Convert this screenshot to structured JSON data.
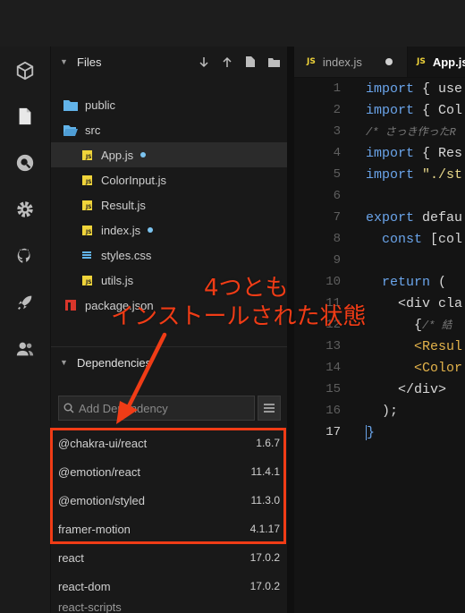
{
  "files_panel": {
    "title": "Files",
    "items": [
      {
        "name": "public",
        "type": "folder"
      },
      {
        "name": "src",
        "type": "folder-open"
      },
      {
        "name": "App.js",
        "type": "js",
        "modified": true,
        "selected": true
      },
      {
        "name": "ColorInput.js",
        "type": "js"
      },
      {
        "name": "Result.js",
        "type": "js"
      },
      {
        "name": "index.js",
        "type": "js",
        "modified": true
      },
      {
        "name": "styles.css",
        "type": "css"
      },
      {
        "name": "utils.js",
        "type": "js"
      },
      {
        "name": "package.json",
        "type": "package"
      }
    ]
  },
  "dependencies_panel": {
    "title": "Dependencies",
    "search_placeholder": "Add Dependency",
    "items": [
      {
        "name": "@chakra-ui/react",
        "version": "1.6.7"
      },
      {
        "name": "@emotion/react",
        "version": "11.4.1"
      },
      {
        "name": "@emotion/styled",
        "version": "11.3.0"
      },
      {
        "name": "framer-motion",
        "version": "4.1.17"
      },
      {
        "name": "react",
        "version": "17.0.2"
      },
      {
        "name": "react-dom",
        "version": "17.0.2"
      }
    ]
  },
  "editor": {
    "tabs": [
      {
        "label": "index.js",
        "modified": true
      },
      {
        "label": "App.js",
        "active": true
      }
    ],
    "line_numbers": [
      "1",
      "2",
      "3",
      "4",
      "5",
      "6",
      "7",
      "8",
      "9",
      "10",
      "11",
      "12",
      "13",
      "14",
      "15",
      "16",
      "17"
    ],
    "current_line": "17",
    "lines": [
      {
        "kw": "import",
        "rest": " { use"
      },
      {
        "kw": "import",
        "rest": " { Col"
      },
      {
        "comment": "/* さっき作ったR"
      },
      {
        "kw": "import",
        "rest": " { Res"
      },
      {
        "kw": "import",
        "str": " \"./st"
      },
      {
        "rest": ""
      },
      {
        "kw": "export",
        "rest": " defau"
      },
      {
        "kw": "  const",
        "rest": " [col"
      },
      {
        "rest": ""
      },
      {
        "kw": "  return",
        "rest": " ("
      },
      {
        "rest": "    <div cla"
      },
      {
        "rest": "      {",
        "comment": "/* 結"
      },
      {
        "tag": "      <Resul"
      },
      {
        "tag": "      <Color"
      },
      {
        "rest": "    </div>"
      },
      {
        "rest": "  );"
      },
      {
        "rest": "}"
      }
    ]
  },
  "annotation": {
    "line1": "4つとも",
    "line2": "インストールされた状態",
    "color": "#f03c16"
  },
  "colors": {
    "js_badge": "#f0d43a",
    "folder": "#62b4ea",
    "modified_dot": "#7cc4f0",
    "keyword": "#6aa4ea"
  }
}
